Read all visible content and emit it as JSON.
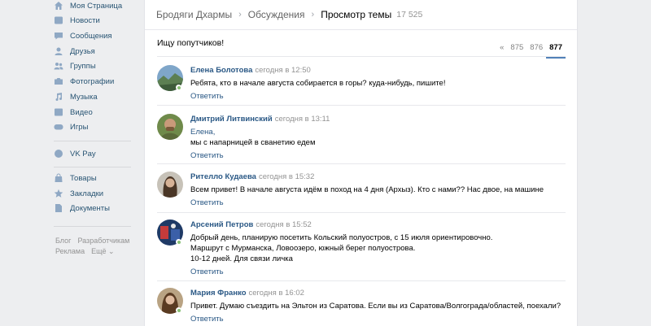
{
  "sidebar": {
    "items": [
      {
        "label": "Моя Страница",
        "icon": "home-icon"
      },
      {
        "label": "Новости",
        "icon": "news-icon"
      },
      {
        "label": "Сообщения",
        "icon": "messages-icon"
      },
      {
        "label": "Друзья",
        "icon": "friends-icon"
      },
      {
        "label": "Группы",
        "icon": "groups-icon"
      },
      {
        "label": "Фотографии",
        "icon": "camera-icon"
      },
      {
        "label": "Музыка",
        "icon": "music-icon"
      },
      {
        "label": "Видео",
        "icon": "video-icon"
      },
      {
        "label": "Игры",
        "icon": "gamepad-icon"
      },
      {
        "label": "VK Pay",
        "icon": "vkpay-icon"
      },
      {
        "label": "Товары",
        "icon": "bag-icon"
      },
      {
        "label": "Закладки",
        "icon": "star-icon"
      },
      {
        "label": "Документы",
        "icon": "document-icon"
      }
    ],
    "footer": {
      "blog": "Блог",
      "developers": "Разработчикам",
      "ads": "Реклама",
      "more": "Ещё ⌄"
    }
  },
  "header": {
    "breadcrumbs": [
      "Бродяги Дхармы",
      "Обсуждения"
    ],
    "current": "Просмотр темы",
    "count": "17 525"
  },
  "topic": {
    "title": "Ищу попутчиков!"
  },
  "pagination": {
    "prev": "«",
    "pages": [
      "875",
      "876",
      "877"
    ],
    "active": "877"
  },
  "posts": [
    {
      "author": "Елена Болотова",
      "time": "сегодня в 12:50",
      "lines": [
        "Ребята, кто в начале августа собирается в горы? куда-нибудь, пишите!"
      ],
      "reply": "Ответить"
    },
    {
      "author": "Дмитрий Литвинский",
      "time": "сегодня в 13:11",
      "lines": [
        "Елена,",
        "мы с напарницей в сванетию едем"
      ],
      "reply": "Ответить"
    },
    {
      "author": "Рителло Кудаева",
      "time": "сегодня в 15:32",
      "lines": [
        "Всем привет! В начале августа идём в поход на 4 дня (Архыз). Кто с нами?? Нас двое, на машине"
      ],
      "reply": "Ответить"
    },
    {
      "author": "Арсений Петров",
      "time": "сегодня в 15:52",
      "lines": [
        "Добрый день, планирую посетить Кольский полуостров, с 15 июля ориентировочно.",
        "Маршрут с Мурманска, Ловоозеро, южный берег полуострова.",
        "10-12 дней. Для связи личка"
      ],
      "reply": "Ответить"
    },
    {
      "author": "Мария Франко",
      "time": "сегодня в 16:02",
      "lines": [
        "Привет. Думаю съездить на Эльтон из Саратова. Если вы из Саратова/Волгограда/областей, поехали?"
      ],
      "reply": "Ответить"
    }
  ]
}
